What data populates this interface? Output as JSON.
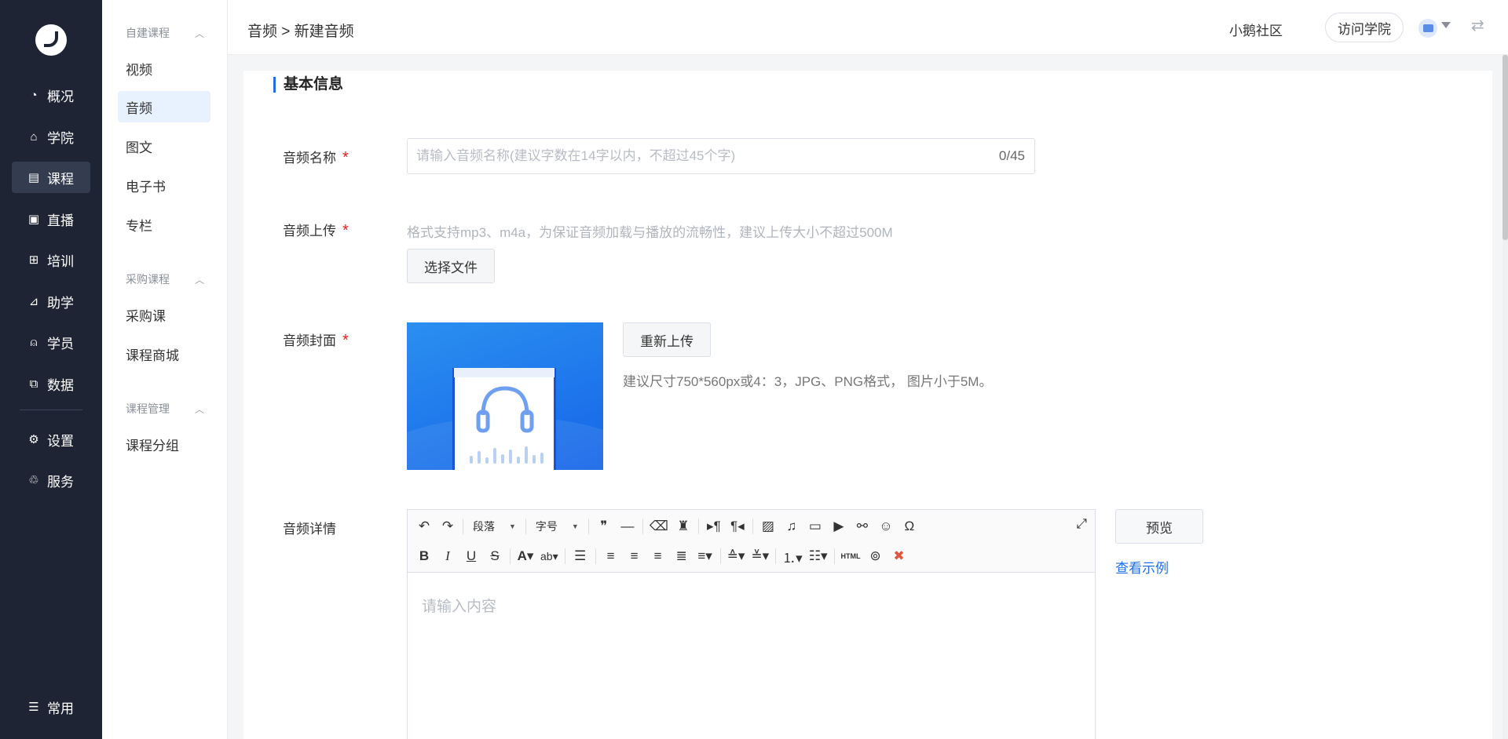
{
  "nav": {
    "items": [
      {
        "label": "概况",
        "icon": "pie-chart-icon"
      },
      {
        "label": "学院",
        "icon": "academy-icon"
      },
      {
        "label": "课程",
        "icon": "course-book-icon",
        "active": true
      },
      {
        "label": "直播",
        "icon": "live-camera-icon"
      },
      {
        "label": "培训",
        "icon": "training-board-icon"
      },
      {
        "label": "助学",
        "icon": "ruler-icon"
      },
      {
        "label": "学员",
        "icon": "user-icon"
      },
      {
        "label": "数据",
        "icon": "data-chart-icon"
      },
      {
        "label": "设置",
        "icon": "gear-icon"
      },
      {
        "label": "服务",
        "icon": "service-hand-icon"
      },
      {
        "label": "常用",
        "icon": "list-icon"
      }
    ]
  },
  "subnav": {
    "groups": [
      {
        "title": "自建课程",
        "items": [
          "视频",
          "音频",
          "图文",
          "电子书",
          "专栏"
        ]
      },
      {
        "title": "采购课程",
        "items": [
          "采购课",
          "课程商城"
        ]
      },
      {
        "title": "课程管理",
        "items": [
          "课程分组"
        ]
      }
    ],
    "active": "音频"
  },
  "header": {
    "breadcrumb": "音频 > 新建音频",
    "community": "小鹅社区",
    "visit_button": "访问学院",
    "store_icon": "store-icon",
    "switch_icon": "swap-arrows-icon"
  },
  "form": {
    "section_title": "基本信息",
    "name": {
      "label": "音频名称",
      "placeholder": "请输入音频名称(建议字数在14字以内，不超过45个字)",
      "value": "",
      "counter": "0/45"
    },
    "upload": {
      "label": "音频上传",
      "hint": "格式支持mp3、m4a，为保证音频加载与播放的流畅性，建议上传大小不超过500M",
      "button": "选择文件"
    },
    "cover": {
      "label": "音频封面",
      "reupload": "重新上传",
      "hint": "建议尺寸750*560px或4：3，JPG、PNG格式， 图片小于5M。"
    },
    "detail": {
      "label": "音频详情",
      "placeholder": "请输入内容",
      "paragraph": "段落",
      "font_size": "字号",
      "html_label": "HTML",
      "preview": "预览",
      "example": "查看示例"
    },
    "required_mark": "*"
  },
  "colors": {
    "nav_bg": "#1e2433",
    "accent": "#1f6fe6",
    "required": "#e02020",
    "active_sub": "#e8f1fe"
  }
}
